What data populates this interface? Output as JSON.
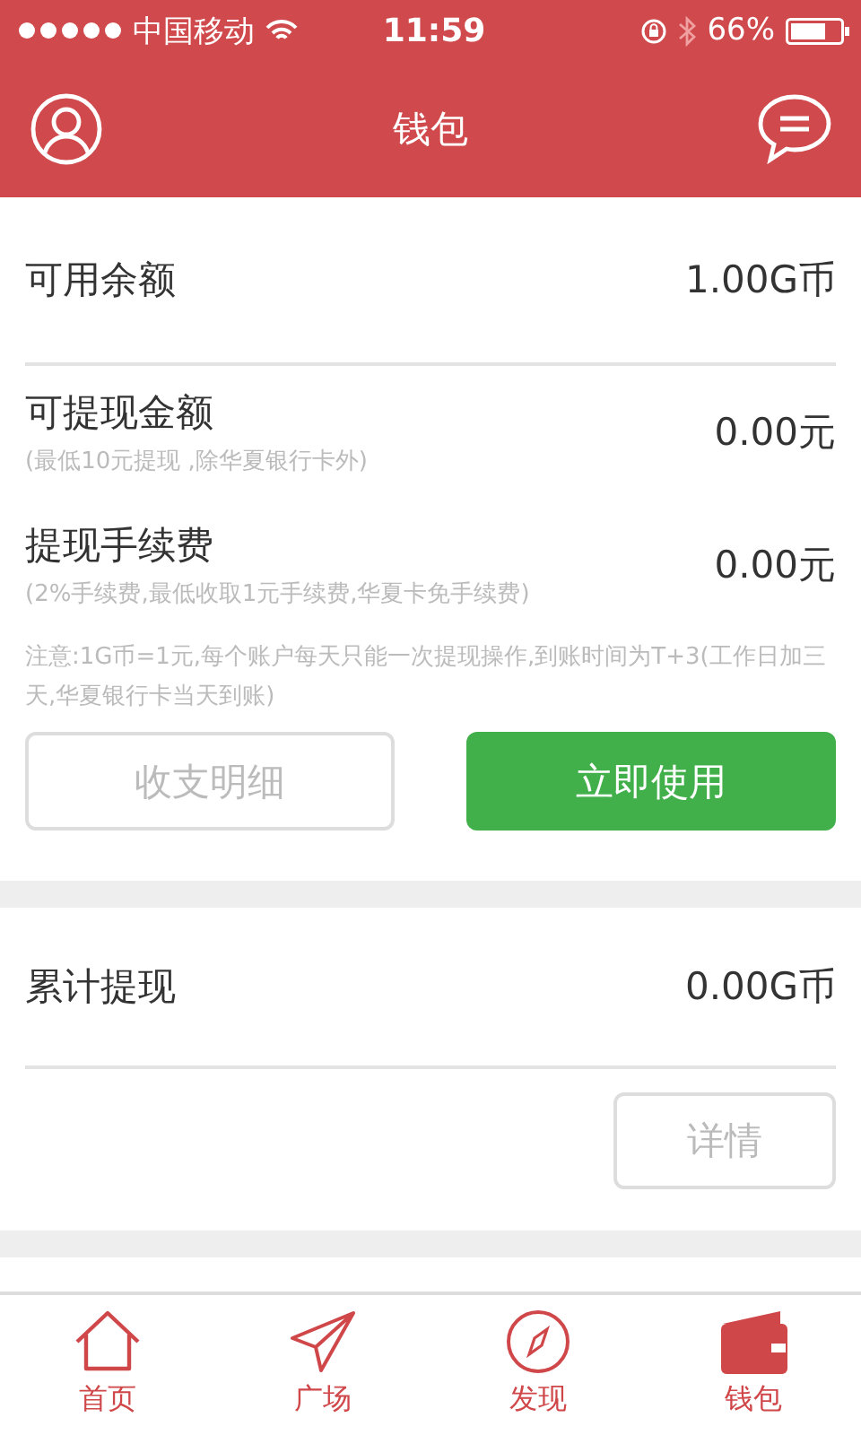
{
  "status_bar": {
    "carrier": "中国移动",
    "time": "11:59",
    "battery_text": "66%"
  },
  "header": {
    "title": "钱包"
  },
  "balance": {
    "label": "可用余额",
    "value": "1.00G币"
  },
  "withdrawable": {
    "label": "可提现金额",
    "hint": "(最低10元提现 ,除华夏银行卡外)",
    "value": "0.00元"
  },
  "fee": {
    "label": "提现手续费",
    "hint": "(2%手续费,最低收取1元手续费,华夏卡免手续费)",
    "value": "0.00元"
  },
  "notice": "注意:1G币=1元,每个账户每天只能一次提现操作,到账时间为T+3(工作日加三天,华夏银行卡当天到账)",
  "buttons": [
    {
      "label": "收支明细",
      "kind": "outline"
    },
    {
      "label": "立即使用",
      "kind": "primary"
    }
  ],
  "total": {
    "label": "累计提现",
    "value": "0.00G币"
  },
  "details_button": {
    "label": "详情"
  },
  "tabs": [
    {
      "label": "首页",
      "kind": "home",
      "selected": false
    },
    {
      "label": "广场",
      "kind": "plane",
      "selected": false
    },
    {
      "label": "发现",
      "kind": "compass",
      "selected": false
    },
    {
      "label": "钱包",
      "kind": "wallet",
      "selected": true
    }
  ]
}
